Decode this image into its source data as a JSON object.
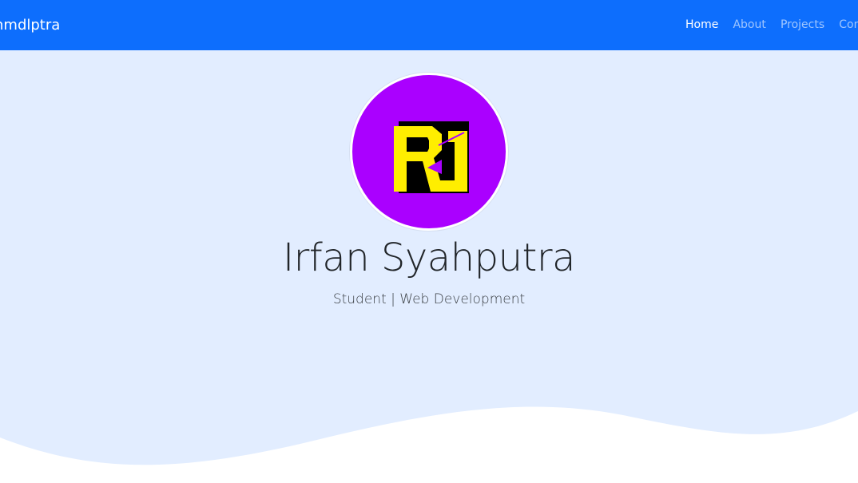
{
  "navbar": {
    "brand": "hmdlptra",
    "links": [
      {
        "label": "Home",
        "active": true
      },
      {
        "label": "About",
        "active": false
      },
      {
        "label": "Projects",
        "active": false
      },
      {
        "label": "Conta",
        "active": false
      }
    ]
  },
  "hero": {
    "avatar_icon": "logo-rs-icon",
    "name": "Irfan Syahputra",
    "subtitle": "Student | Web Development"
  },
  "colors": {
    "navbar_bg": "#0d6efd",
    "hero_bg": "#e2edff",
    "avatar_bg": "#aa00ff",
    "logo_yellow": "#ffee00"
  }
}
